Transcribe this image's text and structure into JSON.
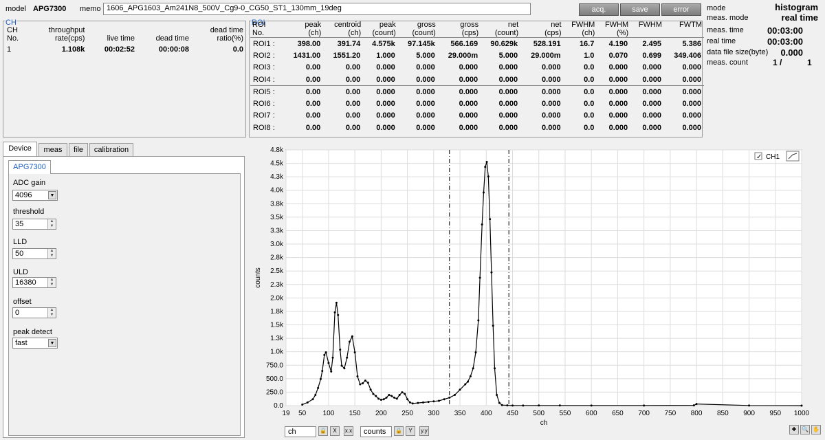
{
  "header": {
    "model_label": "model",
    "model_value": "APG7300",
    "memo_label": "memo",
    "memo_value": "1606_APG1603_Am241N8_500V_Cg9-0_CG50_ST1_130mm_19deg",
    "buttons": {
      "acq": "acq.",
      "save": "save",
      "error": "error"
    }
  },
  "status": {
    "mode_label": "mode",
    "mode_value": "histogram",
    "meas_mode_label": "meas. mode",
    "meas_mode_value": "real time",
    "meas_time_label": "meas. time",
    "meas_time_value": "00:03:00",
    "real_time_label": "real time",
    "real_time_value": "00:03:00",
    "file_size_label": "data file size(byte)",
    "file_size_value": "0.000",
    "meas_count_label": "meas. count",
    "meas_count_current": "1 /",
    "meas_count_total": "1"
  },
  "ch_panel": {
    "title": "CH",
    "headers": [
      "CH\nNo.",
      "throughput\nrate(cps)",
      "live time",
      "dead time",
      "dead time\nratio(%)"
    ],
    "rows": [
      [
        "1",
        "1.108k",
        "00:02:52",
        "00:00:08",
        "0.0"
      ]
    ]
  },
  "roi_panel": {
    "title": "ROI",
    "headers": [
      "ROI\nNo.",
      "peak\n(ch)",
      "centroid\n(ch)",
      "peak\n(count)",
      "gross\n(count)",
      "gross\n(cps)",
      "net\n(count)",
      "net\n(cps)",
      "FWHM\n(ch)",
      "FWHM\n(%)",
      "FWHM",
      "FWTM"
    ],
    "rows": [
      [
        "ROI1 :",
        "398.00",
        "391.74",
        "4.575k",
        "97.145k",
        "566.169",
        "90.629k",
        "528.191",
        "16.7",
        "4.190",
        "2.495",
        "5.386"
      ],
      [
        "ROI2 :",
        "1431.00",
        "1551.20",
        "1.000",
        "5.000",
        "29.000m",
        "5.000",
        "29.000m",
        "1.0",
        "0.070",
        "0.699",
        "349.406"
      ],
      [
        "ROI3 :",
        "0.00",
        "0.00",
        "0.000",
        "0.000",
        "0.000",
        "0.000",
        "0.000",
        "0.0",
        "0.000",
        "0.000",
        "0.000"
      ],
      [
        "ROI4 :",
        "0.00",
        "0.00",
        "0.000",
        "0.000",
        "0.000",
        "0.000",
        "0.000",
        "0.0",
        "0.000",
        "0.000",
        "0.000"
      ],
      [
        "ROI5 :",
        "0.00",
        "0.00",
        "0.000",
        "0.000",
        "0.000",
        "0.000",
        "0.000",
        "0.0",
        "0.000",
        "0.000",
        "0.000"
      ],
      [
        "ROI6 :",
        "0.00",
        "0.00",
        "0.000",
        "0.000",
        "0.000",
        "0.000",
        "0.000",
        "0.0",
        "0.000",
        "0.000",
        "0.000"
      ],
      [
        "ROI7 :",
        "0.00",
        "0.00",
        "0.000",
        "0.000",
        "0.000",
        "0.000",
        "0.000",
        "0.0",
        "0.000",
        "0.000",
        "0.000"
      ],
      [
        "ROI8 :",
        "0.00",
        "0.00",
        "0.000",
        "0.000",
        "0.000",
        "0.000",
        "0.000",
        "0.0",
        "0.000",
        "0.000",
        "0.000"
      ]
    ]
  },
  "tabs": [
    "Device",
    "meas",
    "file",
    "calibration"
  ],
  "device": {
    "subtab": "APG7300",
    "adc_gain_label": "ADC gain",
    "adc_gain_value": "4096",
    "threshold_label": "threshold",
    "threshold_value": "35",
    "lld_label": "LLD",
    "lld_value": "50",
    "uld_label": "ULD",
    "uld_value": "16380",
    "offset_label": "offset",
    "offset_value": "0",
    "peak_detect_label": "peak detect",
    "peak_detect_value": "fast"
  },
  "chart_controls": {
    "x_axis_field": "ch",
    "y_axis_field": "counts"
  },
  "chart_data": {
    "type": "line",
    "xlabel": "ch",
    "ylabel": "counts",
    "xlim": [
      19,
      1000
    ],
    "ylim": [
      0,
      4800
    ],
    "x_ticks": [
      19,
      50,
      100,
      150,
      200,
      250,
      300,
      350,
      400,
      450,
      500,
      550,
      600,
      650,
      700,
      750,
      800,
      850,
      900,
      950,
      1000
    ],
    "y_ticks": [
      "0.0",
      "250.0",
      "500.0",
      "750.0",
      "1.0k",
      "1.3k",
      "1.5k",
      "1.8k",
      "2.0k",
      "2.3k",
      "2.5k",
      "2.8k",
      "3.0k",
      "3.3k",
      "3.5k",
      "3.8k",
      "4.0k",
      "4.3k",
      "4.5k",
      "4.8k"
    ],
    "grid": true,
    "legend": "top-right",
    "series": [
      {
        "name": "CH1",
        "color": "#000000",
        "x": [
          50,
          60,
          70,
          75,
          80,
          85,
          88,
          92,
          95,
          100,
          105,
          108,
          112,
          115,
          118,
          122,
          125,
          130,
          135,
          140,
          145,
          150,
          155,
          160,
          165,
          170,
          175,
          180,
          185,
          190,
          195,
          200,
          205,
          210,
          215,
          220,
          225,
          230,
          235,
          240,
          245,
          250,
          255,
          260,
          270,
          280,
          290,
          300,
          310,
          320,
          330,
          340,
          350,
          360,
          365,
          370,
          375,
          380,
          385,
          388,
          392,
          395,
          398,
          401,
          404,
          407,
          410,
          413,
          416,
          420,
          425,
          430,
          440,
          450,
          470,
          500,
          540,
          600,
          700,
          795,
          800,
          900,
          1000
        ],
        "y": [
          20,
          60,
          120,
          200,
          330,
          500,
          650,
          950,
          1000,
          800,
          640,
          900,
          1750,
          1930,
          1700,
          1050,
          750,
          700,
          900,
          1200,
          1300,
          1000,
          550,
          400,
          420,
          470,
          430,
          300,
          220,
          180,
          130,
          110,
          120,
          150,
          200,
          180,
          150,
          130,
          200,
          250,
          220,
          120,
          60,
          40,
          50,
          60,
          70,
          80,
          90,
          120,
          150,
          200,
          300,
          400,
          450,
          550,
          700,
          1000,
          1600,
          2400,
          3400,
          4000,
          4480,
          4575,
          4300,
          3500,
          2500,
          1500,
          700,
          200,
          50,
          10,
          5,
          2,
          2,
          3,
          3,
          2,
          2,
          5,
          30,
          2,
          0
        ]
      }
    ],
    "markers": [
      330,
      443
    ]
  }
}
